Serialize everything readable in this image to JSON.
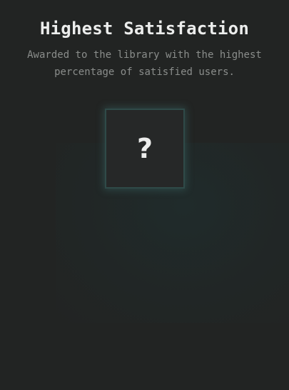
{
  "award": {
    "title": "Highest Satisfaction",
    "description": "Awarded to the library with the highest percentage of satisfied users.",
    "badge_glyph": "?",
    "badge_icon": "unknown-award-icon",
    "locked": true
  },
  "colors": {
    "background": "#222423",
    "title": "#ecedec",
    "description": "#8a8d8b",
    "badge_border": "#2f4a48",
    "badge_glow": "#46827d"
  }
}
